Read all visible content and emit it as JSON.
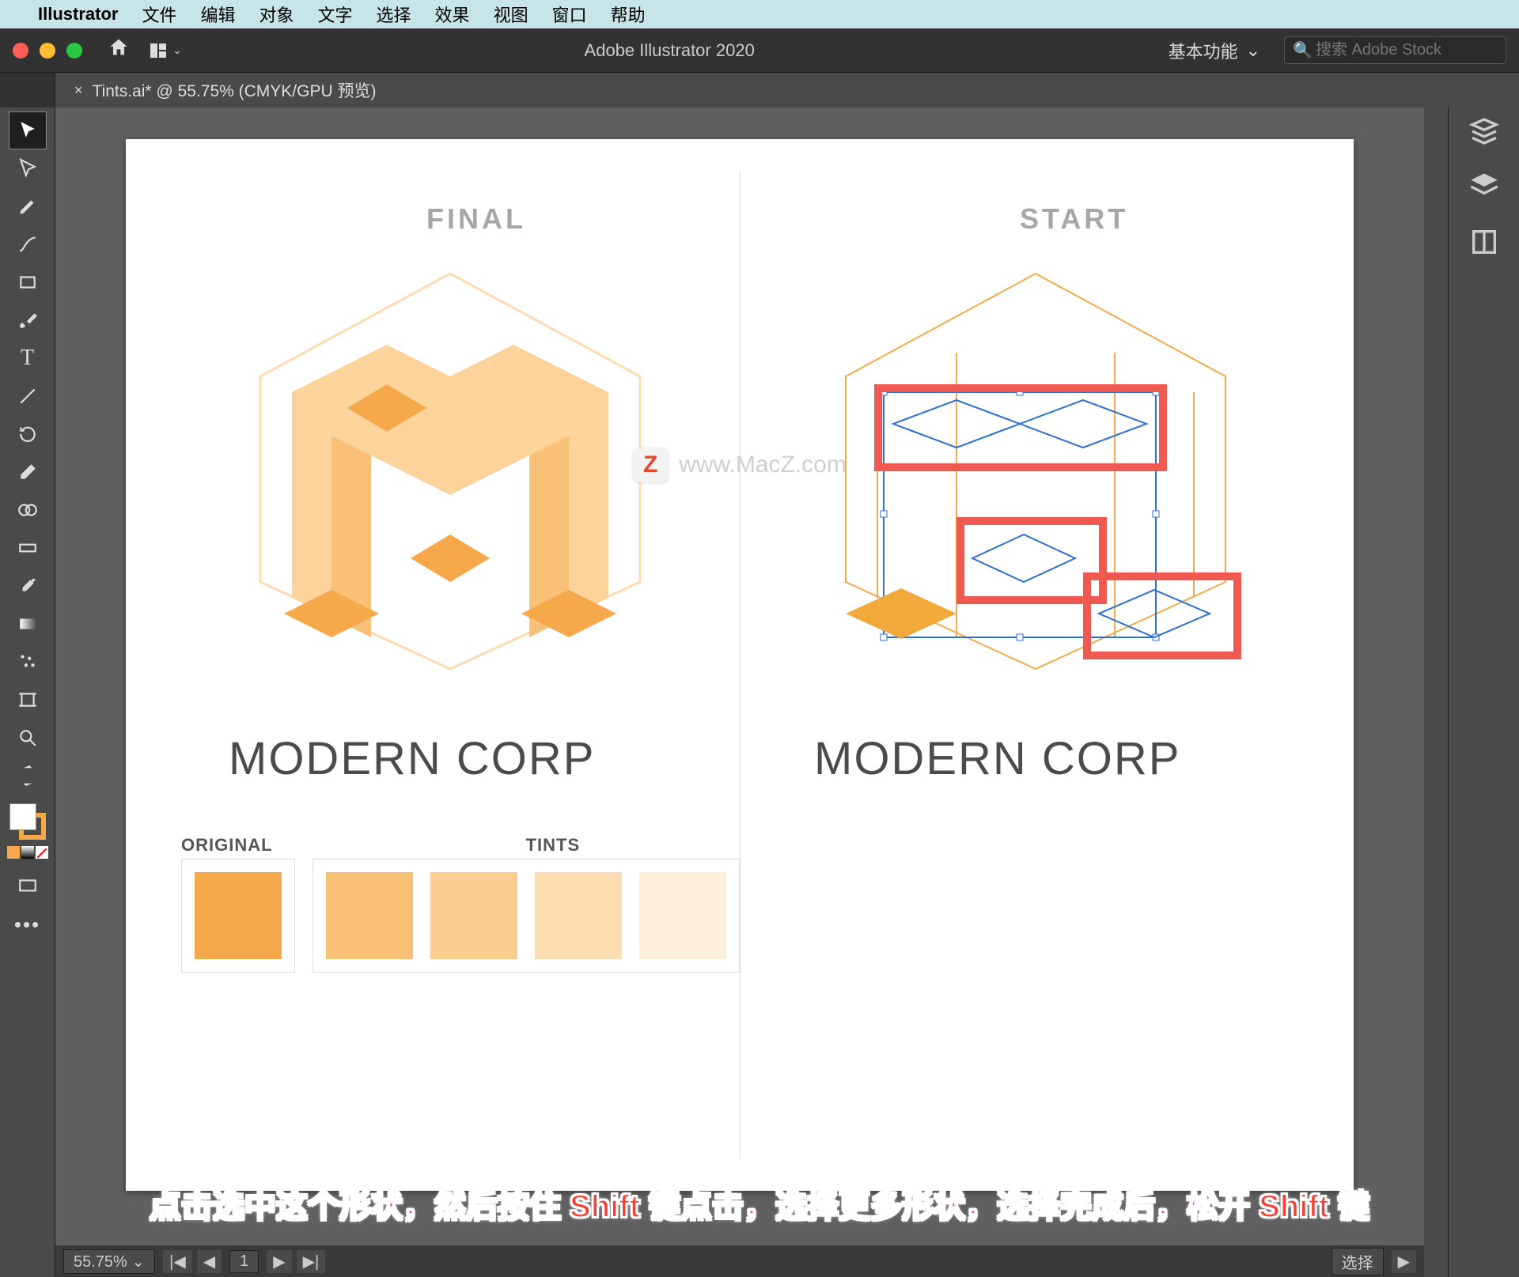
{
  "mac_menu": {
    "app": "Illustrator",
    "items": [
      "文件",
      "编辑",
      "对象",
      "文字",
      "选择",
      "效果",
      "视图",
      "窗口",
      "帮助"
    ]
  },
  "titlebar": {
    "title": "Adobe Illustrator 2020",
    "workspace": "基本功能",
    "search_placeholder": "搜索 Adobe Stock"
  },
  "tab": {
    "close_glyph": "×",
    "label": "Tints.ai* @ 55.75% (CMYK/GPU 预览)"
  },
  "artboard": {
    "final_label": "FINAL",
    "start_label": "START",
    "brand_text": "MODERN CORP",
    "swatch_original_label": "ORIGINAL",
    "swatch_tints_label": "TINTS",
    "swatch_colors": {
      "original": "#f5a94a",
      "tints": [
        "#f9c077",
        "#fbcd91",
        "#fcdcb1",
        "#fdeed9"
      ]
    }
  },
  "watermark": {
    "badge": "Z",
    "text": "www.MacZ.com"
  },
  "instruction_text": "点击选中这个形状，然后按住 Shift 键点击，选择更多形状，选择完成后，松开 Shift 键",
  "statusbar": {
    "zoom": "55.75%",
    "artboard_num": "1",
    "tool_status": "选择"
  },
  "tool_names": [
    "selection",
    "direct-selection",
    "pen",
    "curvature",
    "rectangle",
    "paintbrush",
    "type",
    "line",
    "shape-builder",
    "rotate",
    "eraser",
    "gradient-annotator",
    "width",
    "mesh",
    "eyedropper",
    "symbol-sprayer",
    "column-graph",
    "artboard",
    "slice",
    "zoom"
  ],
  "right_panel_icons": [
    "3d-panel",
    "layers-panel",
    "artboards-panel"
  ]
}
